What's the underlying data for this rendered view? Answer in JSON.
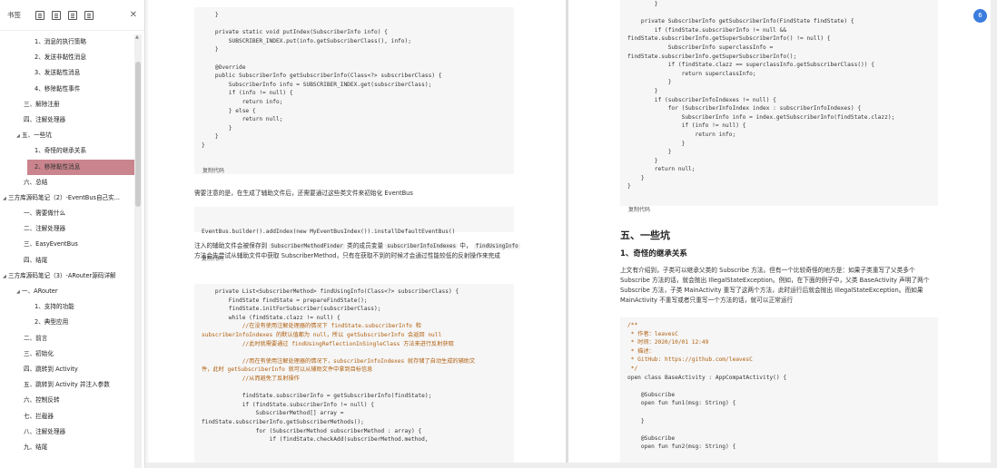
{
  "sidebar": {
    "title": "书签",
    "items": [
      {
        "label": "1、消息的执行策略",
        "level": 2
      },
      {
        "label": "2、发送非黏性消息",
        "level": 2
      },
      {
        "label": "3、发送黏性消息",
        "level": 2
      },
      {
        "label": "4、移除黏性事件",
        "level": 2
      },
      {
        "label": "三、解除注册",
        "level": 1
      },
      {
        "label": "四、注解处理器",
        "level": 1
      },
      {
        "label": "五、一些坑",
        "level": 1,
        "expanded": true
      },
      {
        "label": "1、奇怪的继承关系",
        "level": 2
      },
      {
        "label": "2、移除黏性消息",
        "level": 2,
        "active": true
      },
      {
        "label": "六、总结",
        "level": 1
      },
      {
        "label": "三方库源码笔记（2）-EventBus自己实...",
        "level": 0,
        "expanded": true
      },
      {
        "label": "一、需要做什么",
        "level": 1
      },
      {
        "label": "二、注解处理器",
        "level": 1
      },
      {
        "label": "三、EasyEventBus",
        "level": 1
      },
      {
        "label": "四、结尾",
        "level": 1
      },
      {
        "label": "三方库源码笔记（3）-ARouter源码详解",
        "level": 0,
        "expanded": true
      },
      {
        "label": "一、ARouter",
        "level": 1,
        "expanded": true
      },
      {
        "label": "1、支持的功能",
        "level": 2
      },
      {
        "label": "2、典型应用",
        "level": 2
      },
      {
        "label": "二、前言",
        "level": 1
      },
      {
        "label": "三、初始化",
        "level": 1
      },
      {
        "label": "四、跳转到 Activity",
        "level": 1
      },
      {
        "label": "五、跳转到 Activity 并注入参数",
        "level": 1
      },
      {
        "label": "六、控制反转",
        "level": 1
      },
      {
        "label": "七、拦截器",
        "level": 1
      },
      {
        "label": "八、注解处理器",
        "level": 1
      },
      {
        "label": "九、结尾",
        "level": 1
      }
    ]
  },
  "left": {
    "code1": [
      "    }",
      "",
      "    private static void putIndex(SubscriberInfo info) {",
      "        SUBSCRIBER_INDEX.put(info.getSubscriberClass(), info);",
      "    }",
      "",
      "    @Override",
      "    public SubscriberInfo getSubscriberInfo(Class<?> subscriberClass) {",
      "        SubscriberInfo info = SUBSCRIBER_INDEX.get(subscriberClass);",
      "        if (info != null) {",
      "            return info;",
      "        } else {",
      "            return null;",
      "        }",
      "    }",
      "}"
    ],
    "copy_label": "复制代码",
    "para1": "需要注意的是，在生成了辅助文件后，还需要通过这些类文件来初始化 EventBus",
    "code2": "EventBus.builder().addIndex(new MyEventBusIndex()).installDefaultEventBus()",
    "para2_a": "注入的辅助文件会被保存到",
    "para2_code1": "SubscriberMethodFinder",
    "para2_b": "类的成员变量",
    "para2_code2": "subscriberInfoIndexes",
    "para2_c": "中，",
    "para2_code3": "findUsingInfo",
    "para2_d": "方法会先尝试从辅助文件中获取 SubscriberMethod，只有在获取不到的时候才会通过性能较低的反射操作来完成",
    "code3": [
      "    private List<SubscriberMethod> findUsingInfo(Class<?> subscriberClass) {",
      "        FindState findState = prepareFindState();",
      "        findState.initForSubscriber(subscriberClass);",
      "        while (findState.clazz != null) {",
      "            //在没有使用注解处理器的情况下 findState.subscriberInfo 和",
      "subscriberInfoIndexes 的默认值都为 null，所以 getSubscriberInfo 会返回 null",
      "            //此时就需要通过 findUsingReflectionInSingleClass 方法来进行反射获取",
      "",
      "            //而在有使用注解处理器的情况下，subscriberInfoIndexes 就存储了自动生成的辅助文",
      "件，此时 getSubscriberInfo 就可以从辅助文件中拿到目标信息",
      "            //从而避免了反射操作",
      "",
      "            findState.subscriberInfo = getSubscriberInfo(findState);",
      "            if (findState.subscriberInfo != null) {",
      "                SubscriberMethod[] array =",
      "findState.subscriberInfo.getSubscriberMethods();",
      "                for (SubscriberMethod subscriberMethod : array) {",
      "                    if (findState.checkAdd(subscriberMethod.method,"
    ]
  },
  "right": {
    "code1": [
      "        }",
      "",
      "    private SubscriberInfo getSubscriberInfo(FindState findState) {",
      "        if (findState.subscriberInfo != null &&",
      "findState.subscriberInfo.getSuperSubscriberInfo() != null) {",
      "            SubscriberInfo superclassInfo =",
      "findState.subscriberInfo.getSuperSubscriberInfo();",
      "            if (findState.clazz == superclassInfo.getSubscriberClass()) {",
      "                return superclassInfo;",
      "            }",
      "        }",
      "        if (subscriberInfoIndexes != null) {",
      "            for (SubscriberInfoIndex index : subscriberInfoIndexes) {",
      "                SubscriberInfo info = index.getSubscriberInfo(findState.clazz);",
      "                if (info != null) {",
      "                    return info;",
      "                }",
      "            }",
      "        }",
      "        return null;",
      "    }",
      "}"
    ],
    "copy_label": "复制代码",
    "h_section": "五、一些坑",
    "h_sub": "1、奇怪的继承关系",
    "para": "上文有介绍到，子类可以继承父类的 Subscribe 方法。但有一个比较奇怪的地方是：如果子类重写了父类多个 Subscribe 方法的话，就会抛出 IllegalStateException。例如，在下面的例子中，父类 BaseActivity 声明了两个 Subscribe 方法，子类 MainActivity 重写了这两个方法，此时运行后就会抛出 IllegalStateException。而如果 MainActivity 不重写或者只重写一个方法的话，就可以正常运行",
    "code2": [
      "/**",
      " * 作者：leavesC",
      " * 时间：2020/10/01 12:49",
      " * 描述：",
      " * GitHub: https://github.com/leavesC",
      " */",
      "open class BaseActivity : AppCompatActivity() {",
      "",
      "    @Subscribe",
      "    open fun fun1(msg: String) {",
      "",
      "    }",
      "",
      "    @Subscribe",
      "    open fun fun2(msg: String) {"
    ]
  },
  "fab_label": "6"
}
